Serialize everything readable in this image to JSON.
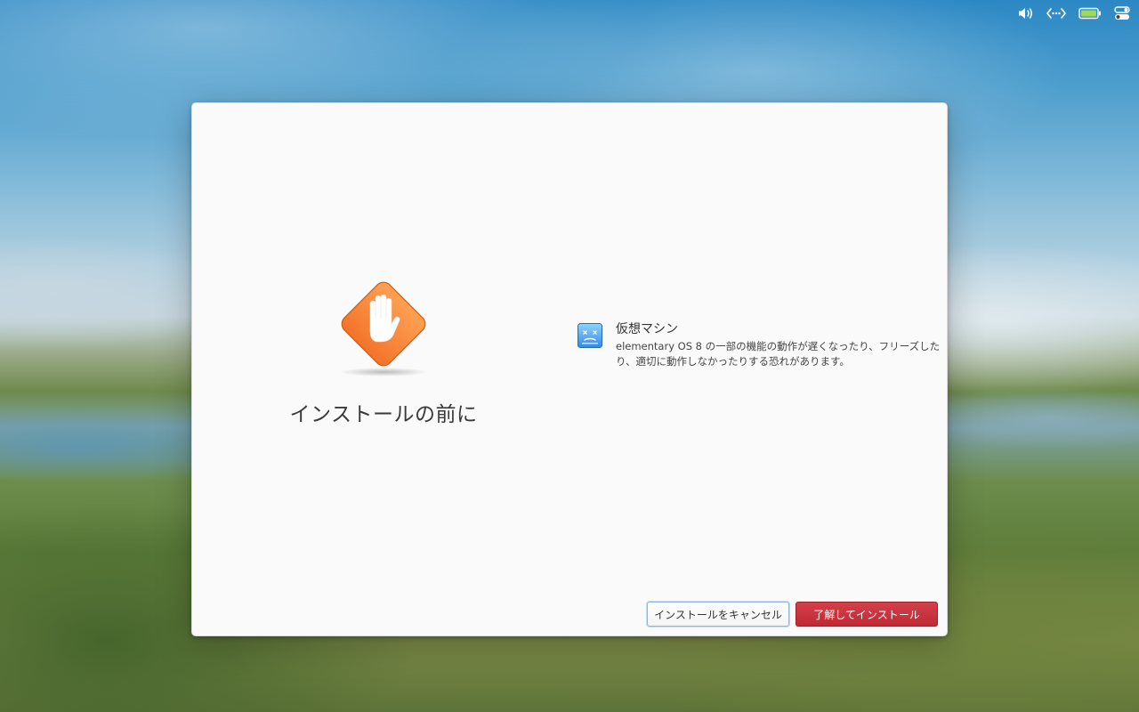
{
  "panel": {
    "indicators": [
      {
        "icon": "volume-icon"
      },
      {
        "icon": "network-icon"
      },
      {
        "icon": "battery-icon",
        "color": "#9bdb4d"
      },
      {
        "icon": "quick-settings-icon"
      }
    ]
  },
  "dialog": {
    "title": "インストールの前に",
    "warning_icon": "hand-stop-icon",
    "issue": {
      "icon": "virtual-machine-icon",
      "title": "仮想マシン",
      "description": "elementary OS 8 の一部の機能の動作が遅くなったり、フリーズしたり、適切に動作しなかったりする恐れがあります。"
    },
    "buttons": {
      "cancel_label": "インストールをキャンセル",
      "install_label": "了解してインストール"
    },
    "colors": {
      "warning": "#f37329",
      "destructive": "#c6262e",
      "accent": "#3689e6"
    }
  }
}
